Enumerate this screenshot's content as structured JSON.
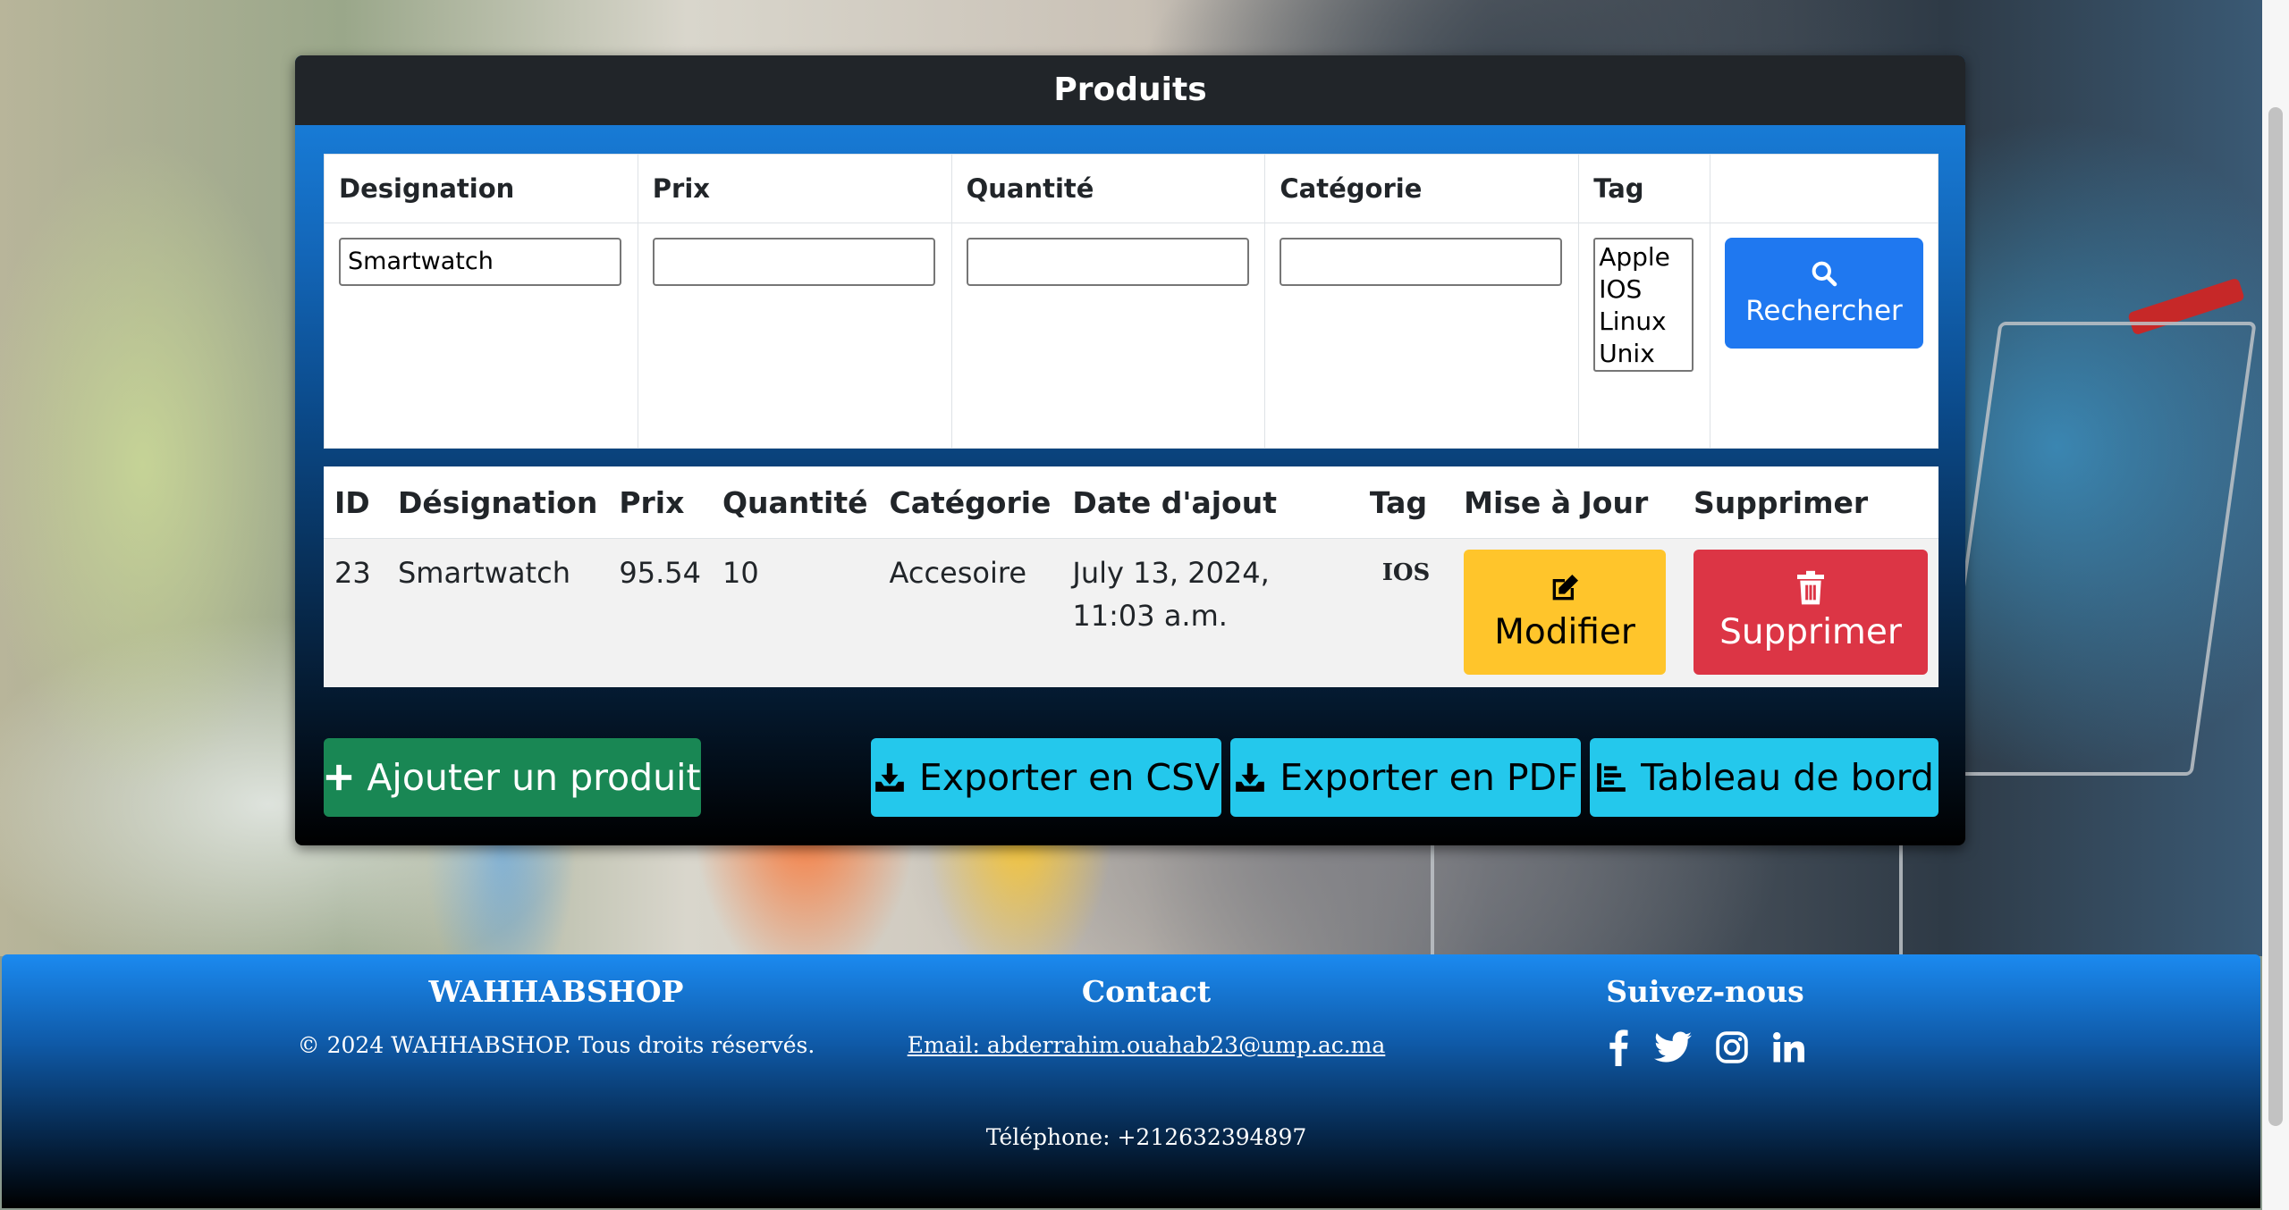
{
  "card": {
    "title": "Produits"
  },
  "filter": {
    "headers": [
      "Designation",
      "Prix",
      "Quantité",
      "Catégorie",
      "Tag"
    ],
    "designation_value": "Smartwatch",
    "prix_value": "",
    "quantite_value": "",
    "categorie_value": "",
    "tag_options": [
      "Apple",
      "IOS",
      "Linux",
      "Unix"
    ],
    "search_label": "Rechercher"
  },
  "products_table": {
    "headers": [
      "ID",
      "Désignation",
      "Prix",
      "Quantité",
      "Catégorie",
      "Date d'ajout",
      "Tag",
      "Mise à Jour",
      "Supprimer"
    ],
    "rows": [
      {
        "id": "23",
        "designation": "Smartwatch",
        "prix": "95.54",
        "quantite": "10",
        "categorie": "Accesoire",
        "date": "July 13, 2024, 11:03 a.m.",
        "tag": "IOS",
        "edit_label": "Modifier",
        "delete_label": "Supprimer"
      }
    ]
  },
  "actions": {
    "add_label": "Ajouter un produit",
    "csv_label": "Exporter en CSV",
    "pdf_label": "Exporter en PDF",
    "dashboard_label": "Tableau de bord"
  },
  "footer": {
    "brand_title": "WAHHABSHOP",
    "copyright": "© 2024 WAHHABSHOP. Tous droits réservés.",
    "contact_title": "Contact",
    "email": "Email: abderrahim.ouahab23@ump.ac.ma",
    "phone": "Téléphone: +212632394897",
    "follow_title": "Suivez-nous",
    "social_icons": [
      "facebook-icon",
      "twitter-icon",
      "instagram-icon",
      "linkedin-icon"
    ]
  },
  "colors": {
    "primary": "#1f78f0",
    "success": "#198754",
    "info": "#24c8ec",
    "warning": "#ffc52b",
    "danger": "#dc3545",
    "header_dark": "#212529"
  }
}
